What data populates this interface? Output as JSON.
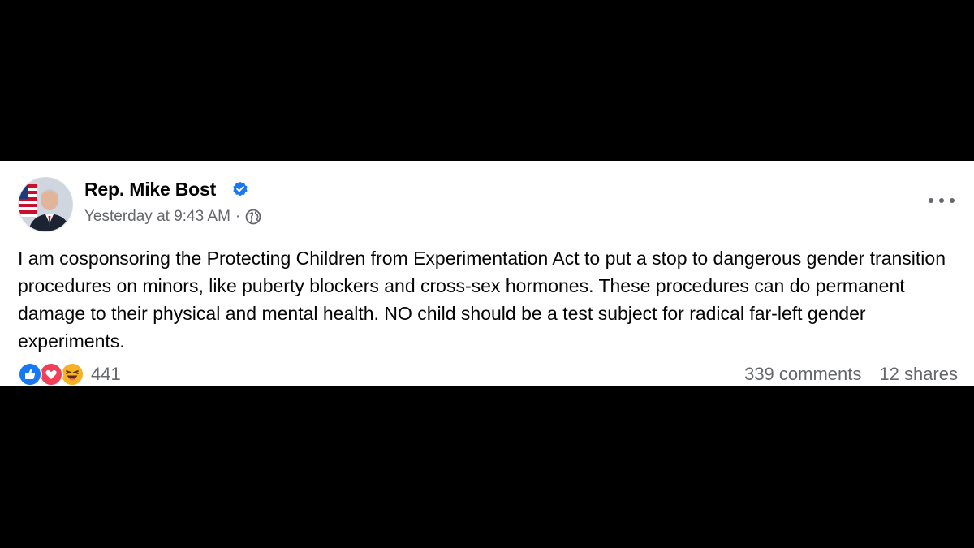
{
  "post": {
    "author": "Rep. Mike Bost",
    "verified": true,
    "timestamp": "Yesterday at 9:43 AM",
    "separator": "·",
    "audience_icon": "globe-icon",
    "text": "I am cosponsoring the Protecting Children from Experimentation Act to put a stop to dangerous gender transition procedures on minors, like puberty blockers and cross-sex hormones. These procedures can do permanent damage to their physical and mental health. NO child should be a test subject for radical far-left gender experiments.",
    "reactions": {
      "icons": [
        "like-icon",
        "love-icon",
        "haha-icon"
      ],
      "count": "441"
    },
    "comments": "339 comments",
    "shares": "12 shares"
  },
  "colors": {
    "background": "#000000",
    "card": "#ffffff",
    "primary_text": "#050505",
    "secondary_text": "#65676b",
    "verified_blue": "#1877f2",
    "like_blue": "#1877f2",
    "love_red": "#f33e58",
    "haha_yellow": "#f7b125"
  }
}
